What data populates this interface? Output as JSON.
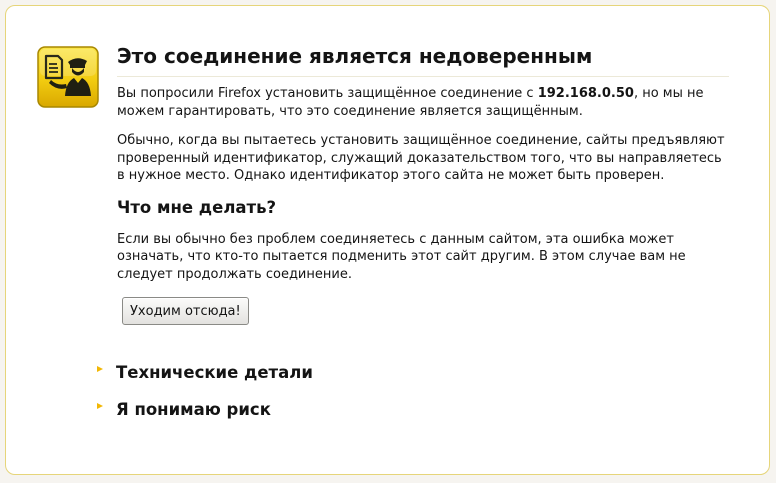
{
  "error": {
    "title": "Это соединение является недоверенным",
    "intro_before": "Вы попросили Firefox установить защищённое соединение с ",
    "host": "192.168.0.50",
    "intro_after": ", но мы не можем гарантировать, что это соединение является защищённым.",
    "explanation": "Обычно, когда вы пытаетесь установить защищённое соединение, сайты предъявляют проверенный идентификатор, служащий доказательством того, что вы направляетесь в нужное место. Однако идентификатор этого сайта не может быть проверен.",
    "what_to_do_heading": "Что мне делать?",
    "what_to_do_text": "Если вы обычно без проблем соединяетесь с данным сайтом, эта ошибка может означать, что кто-то пытается подменить этот сайт другим. В этом случае вам не следует продолжать соединение.",
    "get_me_out_button": "Уходим отсюда!",
    "technical_details_label": "Технические детали",
    "understand_risks_label": "Я понимаю риск"
  },
  "colors": {
    "accent": "#f2b705",
    "border": "#e6d57a",
    "icon_bg": "#f3d21b"
  },
  "icons": {
    "shield": "security-officer-icon",
    "expander": "triangle-right-icon"
  }
}
